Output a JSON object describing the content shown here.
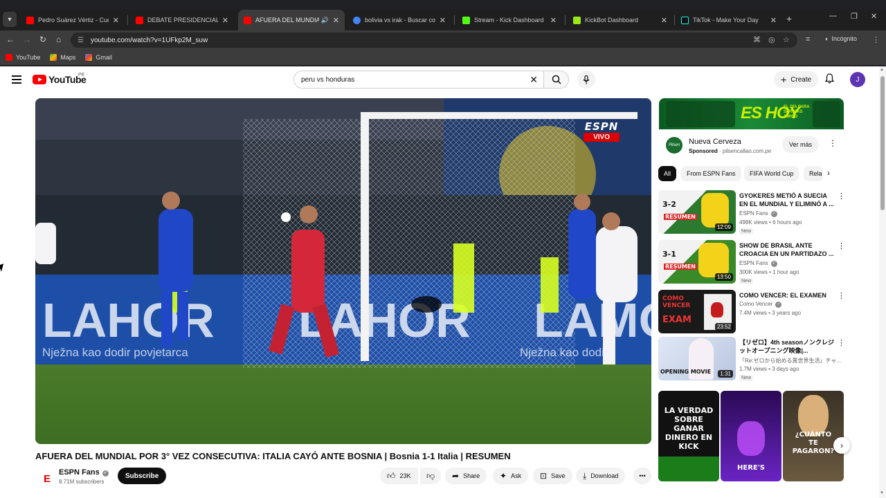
{
  "browser": {
    "tabs": [
      {
        "title": "Pedro Suárez Vértiz - Cuéntame",
        "favicon_color": "#ff0000"
      },
      {
        "title": "DEBATE PRESIDENCIAL 2026 - P",
        "favicon_color": "#ff0000"
      },
      {
        "title": "AFUERA DEL MUNDIAL POR",
        "favicon_color": "#ff0000",
        "active": true
      },
      {
        "title": "bolivia vs irak - Buscar con Goo",
        "favicon_color": "#4285f4"
      },
      {
        "title": "Stream - Kick Dashboard",
        "favicon_color": "#53fc18"
      },
      {
        "title": "KickBot Dashboard",
        "favicon_color": "#9ae81a"
      },
      {
        "title": "TikTok - Make Your Day",
        "favicon_color": "#111111"
      }
    ],
    "url": "youtube.com/watch?v=1UFkp2M_suw",
    "incognito_label": "Incógnito",
    "bookmarks": [
      {
        "label": "YouTube",
        "color": "#ff0000"
      },
      {
        "label": "Maps",
        "color": "#34a853"
      },
      {
        "label": "Gmail",
        "color": "#ea4335"
      }
    ]
  },
  "masthead": {
    "logo_text": "YouTube",
    "country_code": "PE",
    "search_query": "peru vs honduras",
    "create_label": "Create",
    "avatar_letter": "J"
  },
  "video": {
    "overlay_brand": "ESPN",
    "overlay_live": "VIVO",
    "title": "AFUERA DEL MUNDIAL POR 3° VEZ CONSECUTIVA: ITALIA CAYÓ ANTE BOSNIA | Bosnia 1-1 Italia | RESUMEN",
    "channel": "ESPN Fans",
    "subscribers": "8.71M subscribers",
    "subscribe_label": "Subscribe",
    "likes": "23K",
    "share_label": "Share",
    "ask_label": "Ask",
    "save_label": "Save",
    "download_label": "Download"
  },
  "ad": {
    "banner_text": "ES HOY",
    "banner_small": "EL DÍA PARA SER MÁS AMIGO",
    "name": "Nueva Cerveza",
    "sponsored": "Sponsored",
    "domain": "pilsencallao.com.pe",
    "cta": "Ver más"
  },
  "chips": [
    "All",
    "From ESPN Fans",
    "FIFA World Cup",
    "Rela"
  ],
  "recommendations": [
    {
      "title": "GYOKERES METIÓ A SUECIA EN EL MUNDIAL Y ELIMINÓ A ...",
      "channel": "ESPN Fans",
      "meta": "498K views • 6 hours ago",
      "badge": "New",
      "duration": "12:09",
      "thumb_score": "3-2",
      "thumb_tag": "RESUMEN"
    },
    {
      "title": "SHOW DE BRASIL ANTE CROACIA EN UN PARTIDAZO ...",
      "channel": "ESPN Fans",
      "meta": "300K views • 1 hour ago",
      "badge": "New",
      "duration": "13:50",
      "thumb_score": "3-1",
      "thumb_tag": "RESUMEN"
    },
    {
      "title": "COMO VENCER: EL EXAMEN",
      "channel": "Como Vencer",
      "meta": "7.4M views • 3 years ago",
      "badge": "",
      "duration": "23:52",
      "thumb_score": "COMO VENCER",
      "thumb_tag": "EXAM"
    },
    {
      "title": "【リゼロ】4th seasonノンクレジットオープニング映像|...",
      "channel": "「Re:ゼロから始める異世界生活」チャ...",
      "meta": "1.7M views • 3 days ago",
      "badge": "New",
      "duration": "1:31",
      "thumb_score": "",
      "thumb_tag": "OPENING MOVIE"
    }
  ],
  "shorts": [
    {
      "text": "LA VERDAD SOBRE GANAR DINERO EN KICK"
    },
    {
      "text": "HERE'S"
    },
    {
      "text": "¿CUÁNTO TE PAGARON?"
    }
  ]
}
